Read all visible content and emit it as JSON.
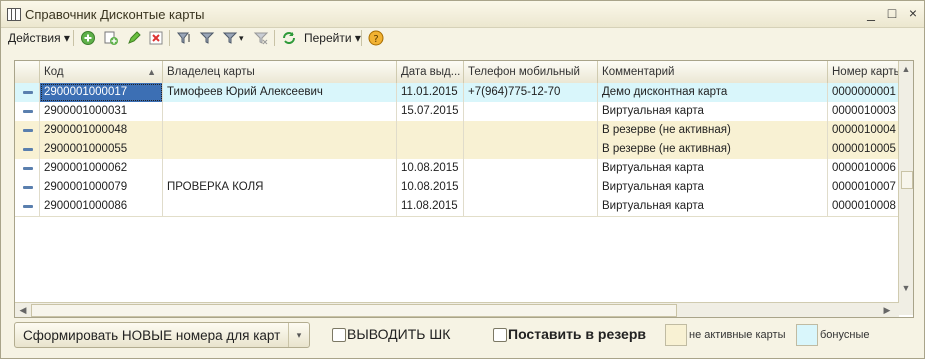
{
  "window": {
    "title": "Справочник Дисконтые карты",
    "controls": {
      "minimize": "_",
      "maximize": "□",
      "close": "×"
    }
  },
  "toolbar": {
    "actions_label": "Действия",
    "goto_label": "Перейти",
    "icons": [
      "add-icon",
      "copy-icon",
      "edit-icon",
      "delete-icon",
      "filter-icon",
      "filter-on-icon",
      "filter-settings-icon",
      "filter-off-icon",
      "refresh-icon",
      "help-icon"
    ]
  },
  "table": {
    "columns": [
      "Код",
      "Владелец карты",
      "Дата выд...",
      "Телефон мобильный",
      "Комментарий",
      "Номер карты"
    ],
    "rows": [
      {
        "code": "2900001000017",
        "owner": "Тимофеев Юрий Алексеевич",
        "date": "11.01.2015",
        "phone": "+7(964)775-12-70",
        "comment": "Демо дисконтная карта",
        "number": "0000000001",
        "status": "bonus"
      },
      {
        "code": "2900001000031",
        "owner": "",
        "date": "15.07.2015",
        "phone": "",
        "comment": "Виртуальная карта",
        "number": "0000010003",
        "status": "normal"
      },
      {
        "code": "2900001000048",
        "owner": "",
        "date": "",
        "phone": "",
        "comment": "В резерве (не активная)",
        "number": "0000010004",
        "status": "inactive"
      },
      {
        "code": "2900001000055",
        "owner": "",
        "date": "",
        "phone": "",
        "comment": "В резерве (не активная)",
        "number": "0000010005",
        "status": "inactive"
      },
      {
        "code": "2900001000062",
        "owner": "",
        "date": "10.08.2015",
        "phone": "",
        "comment": "Виртуальная карта",
        "number": "0000010006",
        "status": "normal"
      },
      {
        "code": "2900001000079",
        "owner": "ПРОВЕРКА КОЛЯ",
        "date": "10.08.2015",
        "phone": "",
        "comment": "Виртуальная карта",
        "number": "0000010007",
        "status": "normal"
      },
      {
        "code": "2900001000086",
        "owner": "",
        "date": "11.08.2015",
        "phone": "",
        "comment": "Виртуальная карта",
        "number": "0000010008",
        "status": "normal"
      }
    ]
  },
  "footer": {
    "generate_button": "Сформировать НОВЫЕ номера для карт",
    "print_barcode_label": "ВЫВОДИТЬ ШК",
    "reserve_label": "Поставить в резерв",
    "legend_inactive": "не активные карты",
    "legend_bonus": "бонусные"
  },
  "colors": {
    "inactive_row": "#f8f1d3",
    "bonus_row": "#d9f6fb",
    "normal_row": "#ffffff",
    "selection": "#3c6fb4"
  }
}
